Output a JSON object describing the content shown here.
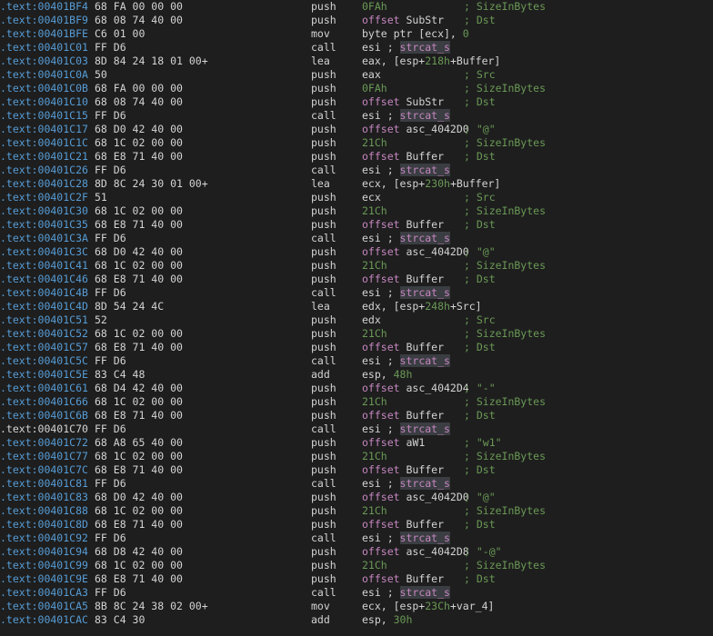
{
  "listing": {
    "rows": [
      {
        "addr": ".text:00401BF4",
        "bytes": "68 FA 00 00 00",
        "mnemonic": "push",
        "operands": [
          {
            "t": "0FAh",
            "c": "num"
          }
        ],
        "comment": "; SizeInBytes"
      },
      {
        "addr": ".text:00401BF9",
        "bytes": "68 08 74 40 00",
        "mnemonic": "push",
        "operands": [
          {
            "t": "offset",
            "c": "kw"
          },
          {
            "t": " SubStr",
            "c": "sym"
          }
        ],
        "comment": "; Dst"
      },
      {
        "addr": ".text:00401BFE",
        "bytes": "C6 01 00",
        "mnemonic": "mov",
        "operands": [
          {
            "t": "byte ptr [ecx], ",
            "c": "txt"
          },
          {
            "t": "0",
            "c": "num"
          }
        ],
        "comment": ""
      },
      {
        "addr": ".text:00401C01",
        "bytes": "FF D6",
        "mnemonic": "call",
        "operands": [
          {
            "t": "esi ; ",
            "c": "reg"
          },
          {
            "t": "strcat_s",
            "c": "fn"
          }
        ],
        "comment": ""
      },
      {
        "addr": ".text:00401C03",
        "bytes": "8D 84 24 18 01 00+",
        "mnemonic": "lea",
        "operands": [
          {
            "t": "eax, [esp+",
            "c": "txt"
          },
          {
            "t": "218h",
            "c": "num"
          },
          {
            "t": "+Buffer]",
            "c": "txt"
          }
        ],
        "comment": ""
      },
      {
        "addr": ".text:00401C0A",
        "bytes": "50",
        "mnemonic": "push",
        "operands": [
          {
            "t": "eax",
            "c": "reg"
          }
        ],
        "comment": "; Src"
      },
      {
        "addr": ".text:00401C0B",
        "bytes": "68 FA 00 00 00",
        "mnemonic": "push",
        "operands": [
          {
            "t": "0FAh",
            "c": "num"
          }
        ],
        "comment": "; SizeInBytes"
      },
      {
        "addr": ".text:00401C10",
        "bytes": "68 08 74 40 00",
        "mnemonic": "push",
        "operands": [
          {
            "t": "offset",
            "c": "kw"
          },
          {
            "t": " SubStr",
            "c": "sym"
          }
        ],
        "comment": "; Dst"
      },
      {
        "addr": ".text:00401C15",
        "bytes": "FF D6",
        "mnemonic": "call",
        "operands": [
          {
            "t": "esi ; ",
            "c": "reg"
          },
          {
            "t": "strcat_s",
            "c": "fn"
          }
        ],
        "comment": ""
      },
      {
        "addr": ".text:00401C17",
        "bytes": "68 D0 42 40 00",
        "mnemonic": "push",
        "operands": [
          {
            "t": "offset",
            "c": "kw"
          },
          {
            "t": " asc_4042D0",
            "c": "sym"
          }
        ],
        "comment": "; \"@\""
      },
      {
        "addr": ".text:00401C1C",
        "bytes": "68 1C 02 00 00",
        "mnemonic": "push",
        "operands": [
          {
            "t": "21Ch",
            "c": "num"
          }
        ],
        "comment": "; SizeInBytes"
      },
      {
        "addr": ".text:00401C21",
        "bytes": "68 E8 71 40 00",
        "mnemonic": "push",
        "operands": [
          {
            "t": "offset",
            "c": "kw"
          },
          {
            "t": " Buffer",
            "c": "sym"
          }
        ],
        "comment": "; Dst"
      },
      {
        "addr": ".text:00401C26",
        "bytes": "FF D6",
        "mnemonic": "call",
        "operands": [
          {
            "t": "esi ; ",
            "c": "reg"
          },
          {
            "t": "strcat_s",
            "c": "fn"
          }
        ],
        "comment": ""
      },
      {
        "addr": ".text:00401C28",
        "bytes": "8D 8C 24 30 01 00+",
        "mnemonic": "lea",
        "operands": [
          {
            "t": "ecx, [esp+",
            "c": "txt"
          },
          {
            "t": "230h",
            "c": "num"
          },
          {
            "t": "+Buffer]",
            "c": "txt"
          }
        ],
        "comment": ""
      },
      {
        "addr": ".text:00401C2F",
        "bytes": "51",
        "mnemonic": "push",
        "operands": [
          {
            "t": "ecx",
            "c": "reg"
          }
        ],
        "comment": "; Src"
      },
      {
        "addr": ".text:00401C30",
        "bytes": "68 1C 02 00 00",
        "mnemonic": "push",
        "operands": [
          {
            "t": "21Ch",
            "c": "num"
          }
        ],
        "comment": "; SizeInBytes"
      },
      {
        "addr": ".text:00401C35",
        "bytes": "68 E8 71 40 00",
        "mnemonic": "push",
        "operands": [
          {
            "t": "offset",
            "c": "kw"
          },
          {
            "t": " Buffer",
            "c": "sym"
          }
        ],
        "comment": "; Dst"
      },
      {
        "addr": ".text:00401C3A",
        "bytes": "FF D6",
        "mnemonic": "call",
        "operands": [
          {
            "t": "esi ; ",
            "c": "reg"
          },
          {
            "t": "strcat_s",
            "c": "fn"
          }
        ],
        "comment": ""
      },
      {
        "addr": ".text:00401C3C",
        "bytes": "68 D0 42 40 00",
        "mnemonic": "push",
        "operands": [
          {
            "t": "offset",
            "c": "kw"
          },
          {
            "t": " asc_4042D0",
            "c": "sym"
          }
        ],
        "comment": "; \"@\""
      },
      {
        "addr": ".text:00401C41",
        "bytes": "68 1C 02 00 00",
        "mnemonic": "push",
        "operands": [
          {
            "t": "21Ch",
            "c": "num"
          }
        ],
        "comment": "; SizeInBytes"
      },
      {
        "addr": ".text:00401C46",
        "bytes": "68 E8 71 40 00",
        "mnemonic": "push",
        "operands": [
          {
            "t": "offset",
            "c": "kw"
          },
          {
            "t": " Buffer",
            "c": "sym"
          }
        ],
        "comment": "; Dst"
      },
      {
        "addr": ".text:00401C4B",
        "bytes": "FF D6",
        "mnemonic": "call",
        "operands": [
          {
            "t": "esi ; ",
            "c": "reg"
          },
          {
            "t": "strcat_s",
            "c": "fn"
          }
        ],
        "comment": ""
      },
      {
        "addr": ".text:00401C4D",
        "bytes": "8D 54 24 4C",
        "mnemonic": "lea",
        "operands": [
          {
            "t": "edx, [esp+",
            "c": "txt"
          },
          {
            "t": "248h",
            "c": "num"
          },
          {
            "t": "+Src]",
            "c": "txt"
          }
        ],
        "comment": ""
      },
      {
        "addr": ".text:00401C51",
        "bytes": "52",
        "mnemonic": "push",
        "operands": [
          {
            "t": "edx",
            "c": "reg"
          }
        ],
        "comment": "; Src"
      },
      {
        "addr": ".text:00401C52",
        "bytes": "68 1C 02 00 00",
        "mnemonic": "push",
        "operands": [
          {
            "t": "21Ch",
            "c": "num"
          }
        ],
        "comment": "; SizeInBytes"
      },
      {
        "addr": ".text:00401C57",
        "bytes": "68 E8 71 40 00",
        "mnemonic": "push",
        "operands": [
          {
            "t": "offset",
            "c": "kw"
          },
          {
            "t": " Buffer",
            "c": "sym"
          }
        ],
        "comment": "; Dst"
      },
      {
        "addr": ".text:00401C5C",
        "bytes": "FF D6",
        "mnemonic": "call",
        "operands": [
          {
            "t": "esi ; ",
            "c": "reg"
          },
          {
            "t": "strcat_s",
            "c": "fn"
          }
        ],
        "comment": ""
      },
      {
        "addr": ".text:00401C5E",
        "bytes": "83 C4 48",
        "mnemonic": "add",
        "operands": [
          {
            "t": "esp, ",
            "c": "txt"
          },
          {
            "t": "48h",
            "c": "num"
          }
        ],
        "comment": ""
      },
      {
        "addr": ".text:00401C61",
        "bytes": "68 D4 42 40 00",
        "mnemonic": "push",
        "operands": [
          {
            "t": "offset",
            "c": "kw"
          },
          {
            "t": " asc_4042D4",
            "c": "sym"
          }
        ],
        "comment": "; \"-\""
      },
      {
        "addr": ".text:00401C66",
        "bytes": "68 1C 02 00 00",
        "mnemonic": "push",
        "operands": [
          {
            "t": "21Ch",
            "c": "num"
          }
        ],
        "comment": "; SizeInBytes"
      },
      {
        "addr": ".text:00401C6B",
        "bytes": "68 E8 71 40 00",
        "mnemonic": "push",
        "operands": [
          {
            "t": "offset",
            "c": "kw"
          },
          {
            "t": " Buffer",
            "c": "sym"
          }
        ],
        "comment": "; Dst"
      },
      {
        "addr": ".text:00401C70",
        "bytes": "FF D6",
        "mnemonic": "call",
        "operands": [
          {
            "t": "esi ; ",
            "c": "reg"
          },
          {
            "t": "strcat_s",
            "c": "fn"
          }
        ],
        "comment": "",
        "current": true
      },
      {
        "addr": ".text:00401C72",
        "bytes": "68 A8 65 40 00",
        "mnemonic": "push",
        "operands": [
          {
            "t": "offset",
            "c": "kw"
          },
          {
            "t": " aW1",
            "c": "sym"
          }
        ],
        "comment": "; \"w1\""
      },
      {
        "addr": ".text:00401C77",
        "bytes": "68 1C 02 00 00",
        "mnemonic": "push",
        "operands": [
          {
            "t": "21Ch",
            "c": "num"
          }
        ],
        "comment": "; SizeInBytes"
      },
      {
        "addr": ".text:00401C7C",
        "bytes": "68 E8 71 40 00",
        "mnemonic": "push",
        "operands": [
          {
            "t": "offset",
            "c": "kw"
          },
          {
            "t": " Buffer",
            "c": "sym"
          }
        ],
        "comment": "; Dst"
      },
      {
        "addr": ".text:00401C81",
        "bytes": "FF D6",
        "mnemonic": "call",
        "operands": [
          {
            "t": "esi ; ",
            "c": "reg"
          },
          {
            "t": "strcat_s",
            "c": "fn"
          }
        ],
        "comment": ""
      },
      {
        "addr": ".text:00401C83",
        "bytes": "68 D0 42 40 00",
        "mnemonic": "push",
        "operands": [
          {
            "t": "offset",
            "c": "kw"
          },
          {
            "t": " asc_4042D0",
            "c": "sym"
          }
        ],
        "comment": "; \"@\""
      },
      {
        "addr": ".text:00401C88",
        "bytes": "68 1C 02 00 00",
        "mnemonic": "push",
        "operands": [
          {
            "t": "21Ch",
            "c": "num"
          }
        ],
        "comment": "; SizeInBytes"
      },
      {
        "addr": ".text:00401C8D",
        "bytes": "68 E8 71 40 00",
        "mnemonic": "push",
        "operands": [
          {
            "t": "offset",
            "c": "kw"
          },
          {
            "t": " Buffer",
            "c": "sym"
          }
        ],
        "comment": "; Dst"
      },
      {
        "addr": ".text:00401C92",
        "bytes": "FF D6",
        "mnemonic": "call",
        "operands": [
          {
            "t": "esi ; ",
            "c": "reg"
          },
          {
            "t": "strcat_s",
            "c": "fn"
          }
        ],
        "comment": ""
      },
      {
        "addr": ".text:00401C94",
        "bytes": "68 D8 42 40 00",
        "mnemonic": "push",
        "operands": [
          {
            "t": "offset",
            "c": "kw"
          },
          {
            "t": " asc_4042D8",
            "c": "sym"
          }
        ],
        "comment": "; \"-@\""
      },
      {
        "addr": ".text:00401C99",
        "bytes": "68 1C 02 00 00",
        "mnemonic": "push",
        "operands": [
          {
            "t": "21Ch",
            "c": "num"
          }
        ],
        "comment": "; SizeInBytes"
      },
      {
        "addr": ".text:00401C9E",
        "bytes": "68 E8 71 40 00",
        "mnemonic": "push",
        "operands": [
          {
            "t": "offset",
            "c": "kw"
          },
          {
            "t": " Buffer",
            "c": "sym"
          }
        ],
        "comment": "; Dst"
      },
      {
        "addr": ".text:00401CA3",
        "bytes": "FF D6",
        "mnemonic": "call",
        "operands": [
          {
            "t": "esi ; ",
            "c": "reg"
          },
          {
            "t": "strcat_s",
            "c": "fn"
          }
        ],
        "comment": ""
      },
      {
        "addr": ".text:00401CA5",
        "bytes": "8B 8C 24 38 02 00+",
        "mnemonic": "mov",
        "operands": [
          {
            "t": "ecx, [esp+",
            "c": "txt"
          },
          {
            "t": "23Ch",
            "c": "num"
          },
          {
            "t": "+var_4]",
            "c": "txt"
          }
        ],
        "comment": ""
      },
      {
        "addr": ".text:00401CAC",
        "bytes": "83 C4 30",
        "mnemonic": "add",
        "operands": [
          {
            "t": "esp, ",
            "c": "txt"
          },
          {
            "t": "30h",
            "c": "num"
          }
        ],
        "comment": ""
      }
    ]
  },
  "colors": {
    "background": "#1e1e1e",
    "address": "#569cd6",
    "keyword": "#c586c0",
    "number": "#6a9955",
    "comment": "#6a9955",
    "text": "#d4d4d4",
    "highlight_bg": "#3a3d41"
  }
}
